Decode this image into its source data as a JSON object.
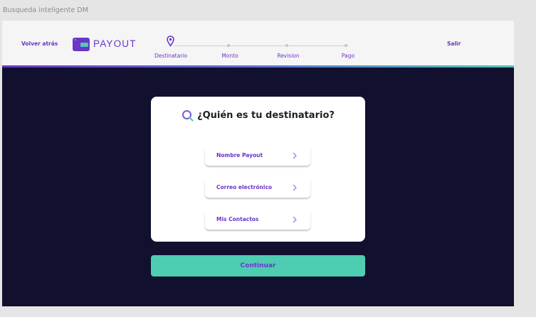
{
  "frame_title": "Busqueda inteligente DM",
  "header": {
    "back_label": "Volver atrás",
    "logo_text": "PAYOUT",
    "logout_label": "Salir",
    "steps": [
      {
        "label": "Destinatario"
      },
      {
        "label": "Monto"
      },
      {
        "label": "Revision"
      },
      {
        "label": "Pago"
      }
    ]
  },
  "card": {
    "title": "¿Quién es tu destinatario?",
    "options": [
      {
        "label": "Nombre Payout"
      },
      {
        "label": "Correo electrónico"
      },
      {
        "label": "Mis Contactos"
      }
    ]
  },
  "continue_label": "Continuar",
  "colors": {
    "accent": "#6a35c9",
    "teal": "#4ecdb2",
    "background": "#11102f"
  },
  "icons": {
    "logo": "wallet-icon",
    "step_marker": "map-pin-icon",
    "search": "search-icon",
    "chevron": "chevron-right-icon"
  }
}
